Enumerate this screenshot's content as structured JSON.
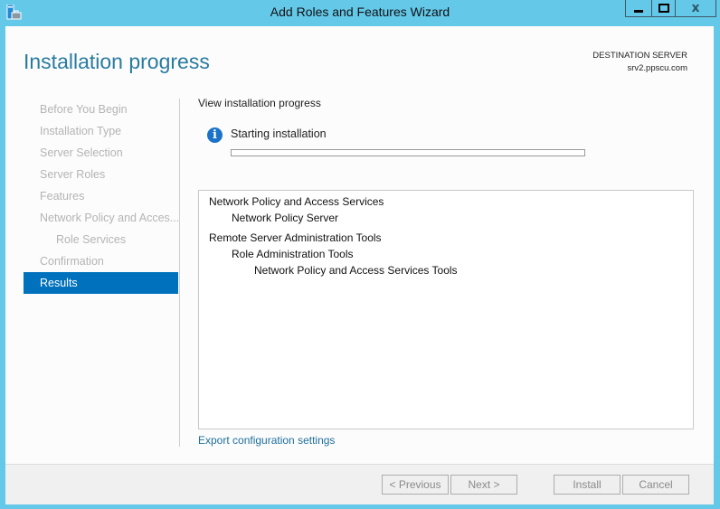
{
  "window": {
    "title": "Add Roles and Features Wizard",
    "controls": {
      "minimize": "minimize",
      "maximize": "maximize",
      "close": "x"
    }
  },
  "header": {
    "page_title": "Installation progress",
    "destination_label": "DESTINATION SERVER",
    "destination_server": "srv2.ppscu.com"
  },
  "nav": {
    "items": [
      {
        "label": "Before You Begin",
        "state": "disabled"
      },
      {
        "label": "Installation Type",
        "state": "disabled"
      },
      {
        "label": "Server Selection",
        "state": "disabled"
      },
      {
        "label": "Server Roles",
        "state": "disabled"
      },
      {
        "label": "Features",
        "state": "disabled"
      },
      {
        "label": "Network Policy and Acces...",
        "state": "disabled"
      },
      {
        "label": "Role Services",
        "state": "disabled",
        "indent": 1
      },
      {
        "label": "Confirmation",
        "state": "disabled"
      },
      {
        "label": "Results",
        "state": "active"
      }
    ]
  },
  "main": {
    "section_heading": "View installation progress",
    "status_icon": "info-icon",
    "status_text": "Starting installation",
    "progress_percent": 0,
    "results": [
      {
        "label": "Network Policy and Access Services",
        "level": 0
      },
      {
        "label": "Network Policy Server",
        "level": 1
      },
      {
        "label": "Remote Server Administration Tools",
        "level": 0
      },
      {
        "label": "Role Administration Tools",
        "level": 1
      },
      {
        "label": "Network Policy and Access Services Tools",
        "level": 2
      }
    ],
    "export_link": "Export configuration settings"
  },
  "footer": {
    "previous_label": "< Previous",
    "next_label": "Next >",
    "install_label": "Install",
    "cancel_label": "Cancel"
  },
  "colors": {
    "frame": "#64c8e9",
    "accent": "#0071bc",
    "title_text": "#2a7ba0",
    "link": "#1f6f9c"
  }
}
